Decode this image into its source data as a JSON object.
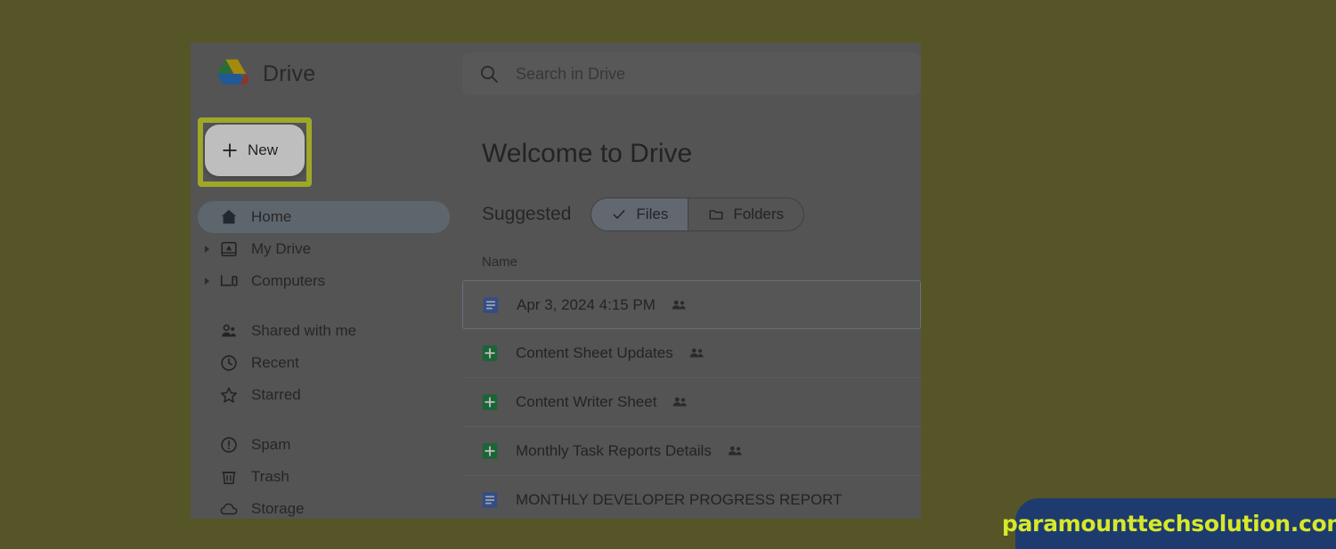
{
  "background": {
    "page_color": "#555527",
    "panel_color": "#676767"
  },
  "header": {
    "brand_name": "Drive",
    "logo_icon": "google-drive-logo",
    "search": {
      "icon": "search-icon",
      "placeholder": "Search in Drive",
      "value": ""
    }
  },
  "sidebar": {
    "new_button": {
      "label": "New",
      "icon": "plus-icon",
      "highlighted": true,
      "highlight_color": "#d2e029"
    },
    "items": [
      {
        "label": "Home",
        "icon": "home-icon",
        "selected": true,
        "expandable": false
      },
      {
        "label": "My Drive",
        "icon": "my-drive-icon",
        "selected": false,
        "expandable": true
      },
      {
        "label": "Computers",
        "icon": "computer-icon",
        "selected": false,
        "expandable": true
      },
      {
        "label": "Shared with me",
        "icon": "people-icon",
        "selected": false,
        "expandable": false
      },
      {
        "label": "Recent",
        "icon": "clock-icon",
        "selected": false,
        "expandable": false
      },
      {
        "label": "Starred",
        "icon": "star-icon",
        "selected": false,
        "expandable": false
      },
      {
        "label": "Spam",
        "icon": "spam-icon",
        "selected": false,
        "expandable": false
      },
      {
        "label": "Trash",
        "icon": "trash-icon",
        "selected": false,
        "expandable": false
      },
      {
        "label": "Storage",
        "icon": "cloud-icon",
        "selected": false,
        "expandable": false
      }
    ]
  },
  "main": {
    "title": "Welcome to Drive",
    "filter": {
      "label": "Suggested",
      "chips": [
        {
          "label": "Files",
          "icon": "check-icon",
          "active": true
        },
        {
          "label": "Folders",
          "icon": "folder-icon",
          "active": false
        }
      ]
    },
    "column_header": "Name",
    "files": [
      {
        "name": "Apr 3, 2024 4:15 PM",
        "type": "doc",
        "icon": "google-docs-icon",
        "shared": true,
        "active": true
      },
      {
        "name": "Content Sheet Updates",
        "type": "sheet",
        "icon": "google-sheets-icon",
        "shared": true,
        "active": false
      },
      {
        "name": "Content Writer Sheet",
        "type": "sheet",
        "icon": "google-sheets-icon",
        "shared": true,
        "active": false
      },
      {
        "name": "Monthly Task Reports Details",
        "type": "sheet",
        "icon": "google-sheets-icon",
        "shared": true,
        "active": false
      },
      {
        "name": "MONTHLY DEVELOPER PROGRESS REPORT",
        "type": "doc",
        "icon": "google-docs-icon",
        "shared": false,
        "active": false
      }
    ]
  },
  "watermark": {
    "text": "paramounttechsolution.com",
    "background_color": "#1d3b6e",
    "text_color": "#d7e82a"
  }
}
